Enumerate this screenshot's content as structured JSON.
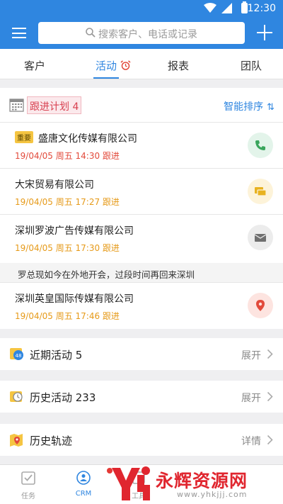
{
  "status_bar": {
    "time": "12:30"
  },
  "search": {
    "placeholder": "搜索客户、电话或记录"
  },
  "tabs": [
    {
      "label": "客户"
    },
    {
      "label": "活动"
    },
    {
      "label": "报表"
    },
    {
      "label": "团队"
    }
  ],
  "plan": {
    "title": "跟进计划 4",
    "sort_label": "智能排序"
  },
  "followups": [
    {
      "tag": "重要",
      "name": "盛唐文化传媒有限公司",
      "meta": "19/04/05 周五 14:30 跟进",
      "meta_color": "#e24a3b",
      "action_icon": "phone-icon"
    },
    {
      "name": "大宋贸易有限公司",
      "meta": "19/04/05 周五 17:27 跟进",
      "meta_color": "#e69a19",
      "action_icon": "chat-icon"
    },
    {
      "name": "深圳罗波广告传媒有限公司",
      "meta": "19/04/05 周五 17:30 跟进",
      "meta_color": "#e69a19",
      "action_icon": "mail-icon"
    },
    {
      "name": "深圳英皇国际传媒有限公司",
      "meta": "19/04/05 周五 17:46 跟进",
      "meta_color": "#e69a19",
      "action_icon": "location-icon"
    }
  ],
  "note": "罗总现如今在外地开会，过段时间再回来深圳",
  "sections": [
    {
      "label": "近期活动 5",
      "action": "展开",
      "icon": "calendar-48-icon"
    },
    {
      "label": "历史活动 233",
      "action": "展开",
      "icon": "clock-folder-icon"
    },
    {
      "label": "历史轨迹",
      "action": "详情",
      "icon": "map-pin-icon"
    }
  ],
  "bottom_nav": [
    {
      "label": "任务"
    },
    {
      "label": "CRM"
    },
    {
      "label": "工具"
    }
  ],
  "watermark": {
    "text": "永辉资源网",
    "url": "www.yhkjjj.com"
  },
  "colors": {
    "primary": "#2f86e0",
    "danger": "#e24a3b",
    "warning": "#e69a19"
  }
}
